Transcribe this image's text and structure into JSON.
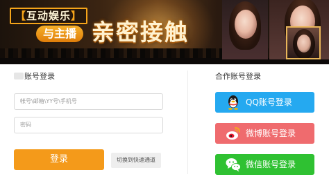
{
  "banner": {
    "tag": "互动娱乐",
    "tag_left_bracket": "【",
    "tag_right_bracket": "】",
    "subtitle": "与主播",
    "headline": "亲密接触"
  },
  "login": {
    "title": "账号登录",
    "account_placeholder": "帐号\\邮箱\\YY号\\手机号",
    "password_placeholder": "密码",
    "login_button": "登录",
    "switch_button": "切换到快速通道"
  },
  "partner": {
    "title": "合作账号登录",
    "qq_label": "QQ账号登录",
    "weibo_label": "微博账号登录",
    "wechat_label": "微信账号登录"
  },
  "colors": {
    "login_button": "#f49a1a",
    "qq": "#25a9f0",
    "weibo": "#ef6b6e",
    "wechat": "#2fc132"
  }
}
